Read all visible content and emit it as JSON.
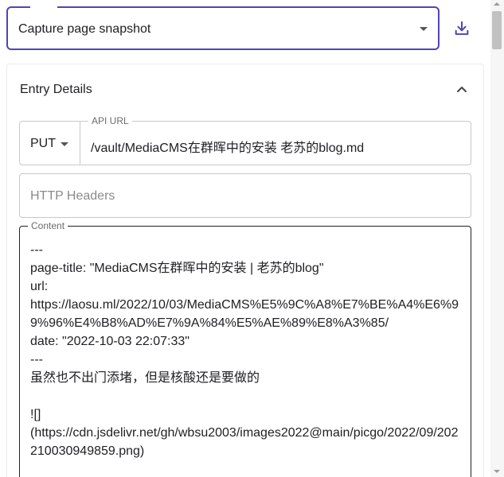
{
  "top": {
    "action_select": "Capture page snapshot",
    "download_icon": "download-icon"
  },
  "panel": {
    "title": "Entry Details",
    "collapse_icon": "chevron-up-icon"
  },
  "request": {
    "method": "PUT",
    "api_url_label": "API URL",
    "api_url_value": "/vault/MediaCMS在群晖中的安装  老苏的blog.md",
    "headers_placeholder": "HTTP Headers"
  },
  "content": {
    "label": "Content",
    "text": "---\npage-title: \"MediaCMS在群晖中的安装 | 老苏的blog\"\nurl:\nhttps://laosu.ml/2022/10/03/MediaCMS%E5%9C%A8%E7%BE%A4%E6%99%96%E4%B8%AD%E7%9A%84%E5%AE%89%E8%A3%85/\ndate: \"2022-10-03 22:07:33\"\n---\n虽然也不出门添堵，但是核酸还是要做的\n\n![]\n(https://cdn.jsdelivr.net/gh/wbsu2003/images2022@main/picgo/2022/09/202210030949859.png)"
  }
}
